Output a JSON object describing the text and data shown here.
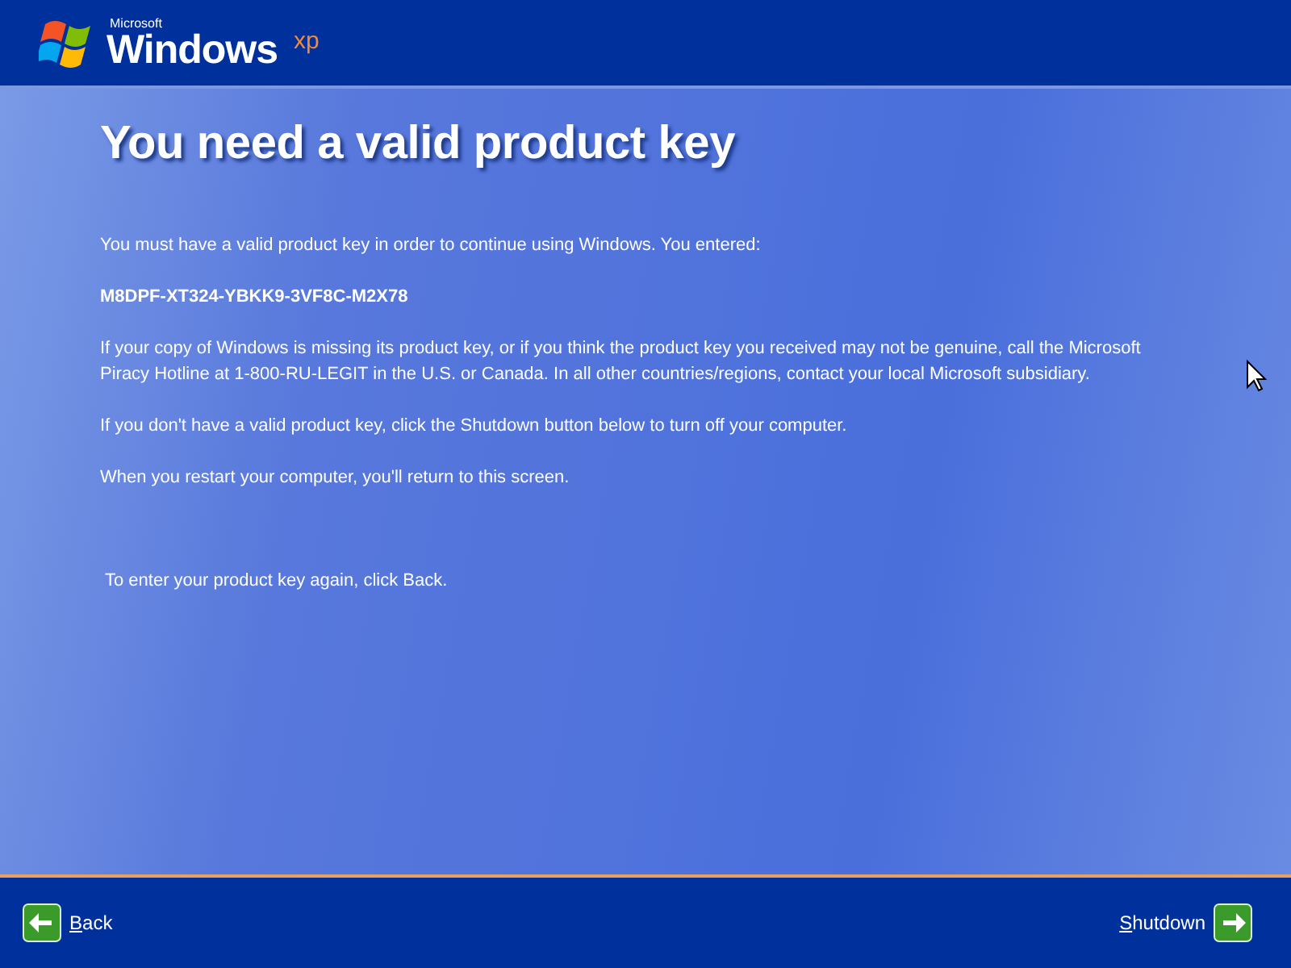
{
  "logo": {
    "company": "Microsoft",
    "product": "Windows",
    "edition": "xp"
  },
  "title": "You need a valid product key",
  "paragraphs": [
    {
      "kind": "text",
      "text": "You must have a valid product key in order to continue using Windows. You entered:"
    },
    {
      "kind": "key",
      "text": "M8DPF-XT324-YBKK9-3VF8C-M2X78"
    },
    {
      "kind": "text",
      "text": "If your copy of Windows is missing its product key, or if you think the product key you received may not be genuine, call the Microsoft Piracy Hotline at 1-800-RU-LEGIT in the U.S. or Canada. In all other countries/regions, contact your local Microsoft subsidiary."
    },
    {
      "kind": "text",
      "text": "If you don't have a valid product key, click the Shutdown button below to turn off your computer."
    },
    {
      "kind": "text",
      "text": "When you restart your computer, you'll return to this screen."
    }
  ],
  "hint": "To enter your product key again, click Back.",
  "buttons": {
    "back": "Back",
    "next": "Shutdown"
  }
}
